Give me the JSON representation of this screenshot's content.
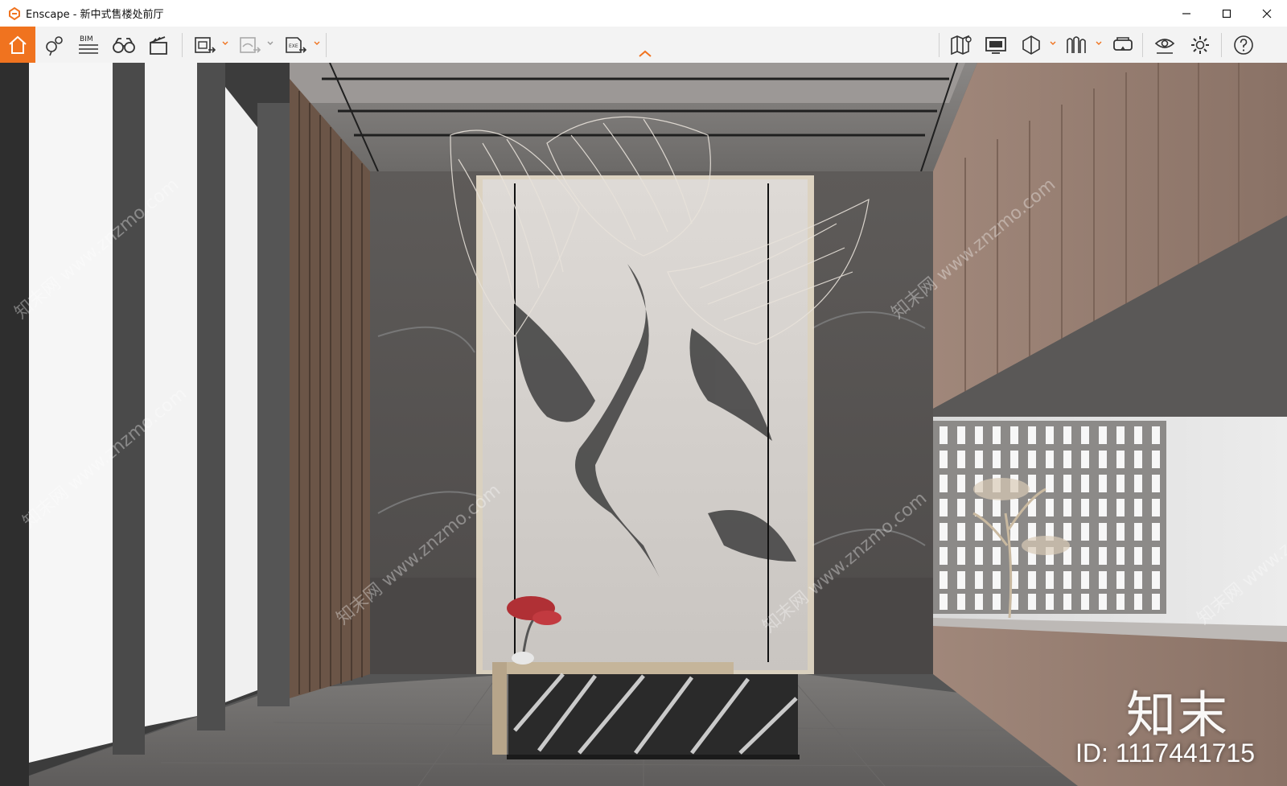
{
  "window": {
    "title": "Enscape - 新中式售楼处前厅"
  },
  "colors": {
    "accent": "#f0731f",
    "toolbar_bg": "#f3f3f3"
  },
  "toolbar": {
    "left": [
      {
        "name": "home-icon",
        "label": "home"
      },
      {
        "name": "locator-icon",
        "label": "locator"
      },
      {
        "name": "bim-icon",
        "label": "BIM"
      },
      {
        "name": "binoculars-icon",
        "label": "views"
      },
      {
        "name": "clapperboard-icon",
        "label": "video"
      },
      {
        "name": "screenshot-export-icon",
        "label": "export image"
      },
      {
        "name": "panorama-export-icon",
        "label": "export panorama"
      },
      {
        "name": "exe-export-icon",
        "label": "EXE"
      }
    ],
    "right": [
      {
        "name": "map-icon"
      },
      {
        "name": "monitor-icon"
      },
      {
        "name": "cube-icon"
      },
      {
        "name": "library-icon"
      },
      {
        "name": "vr-headset-icon"
      },
      {
        "name": "view-eye-icon"
      },
      {
        "name": "settings-gear-icon"
      },
      {
        "name": "help-icon"
      }
    ]
  },
  "viewport": {
    "watermark_text": "知末网 www.znzmo.com",
    "brand_logo": "知末",
    "brand_id": "ID: 1117441715"
  }
}
